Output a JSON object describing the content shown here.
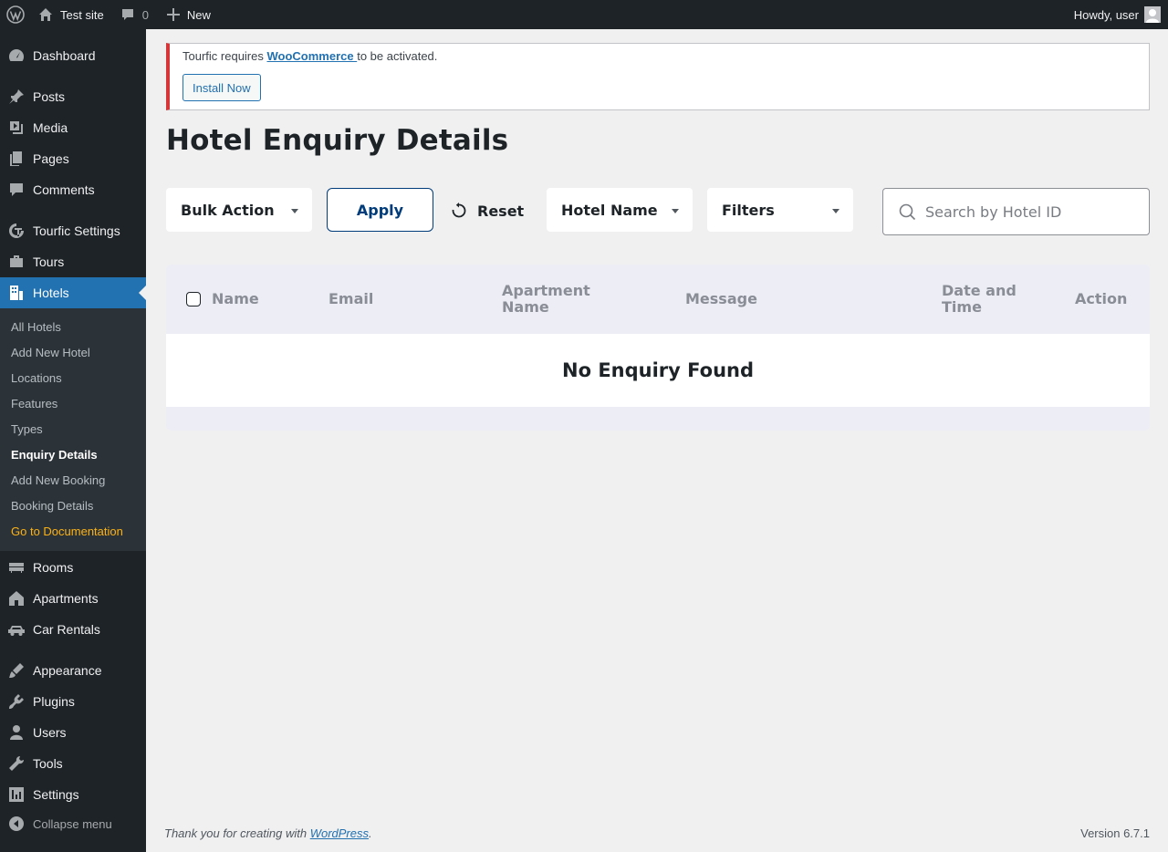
{
  "adminbar": {
    "site_name": "Test site",
    "comments_count": "0",
    "new_label": "New",
    "greeting": "Howdy, user"
  },
  "sidebar": {
    "items": [
      {
        "label": "Dashboard",
        "icon": "dashboard-icon"
      },
      {
        "label": "Posts",
        "icon": "pin-icon"
      },
      {
        "label": "Media",
        "icon": "media-icon"
      },
      {
        "label": "Pages",
        "icon": "pages-icon"
      },
      {
        "label": "Comments",
        "icon": "comment-icon"
      },
      {
        "label": "Tourfic Settings",
        "icon": "tourfic-icon"
      },
      {
        "label": "Tours",
        "icon": "tours-icon"
      },
      {
        "label": "Hotels",
        "icon": "hotel-icon"
      },
      {
        "label": "Rooms",
        "icon": "bed-icon"
      },
      {
        "label": "Apartments",
        "icon": "home-icon"
      },
      {
        "label": "Car Rentals",
        "icon": "car-icon"
      },
      {
        "label": "Appearance",
        "icon": "brush-icon"
      },
      {
        "label": "Plugins",
        "icon": "plugin-icon"
      },
      {
        "label": "Users",
        "icon": "user-icon"
      },
      {
        "label": "Tools",
        "icon": "wrench-icon"
      },
      {
        "label": "Settings",
        "icon": "settings-icon"
      }
    ],
    "submenu": [
      "All Hotels",
      "Add New Hotel",
      "Locations",
      "Features",
      "Types",
      "Enquiry Details",
      "Add New Booking",
      "Booking Details",
      "Go to Documentation"
    ],
    "collapse_label": "Collapse menu"
  },
  "notice": {
    "text_before": "Tourfic requires ",
    "link_text": "WooCommerce ",
    "text_after": "to be activated.",
    "button_label": "Install Now",
    "accent_color": "#d63638"
  },
  "page": {
    "title": "Hotel Enquiry Details"
  },
  "filters": {
    "bulk_action": "Bulk Action",
    "apply": "Apply",
    "reset": "Reset",
    "hotel_name": "Hotel Name",
    "filters": "Filters",
    "search_placeholder": "Search by Hotel ID"
  },
  "table": {
    "columns": [
      "Name",
      "Email",
      "Apartment Name",
      "Message",
      "Date and Time",
      "Action"
    ],
    "empty_message": "No Enquiry Found"
  },
  "footer": {
    "text_before": "Thank you for creating with ",
    "link_text": "WordPress",
    "text_after": ".",
    "version": "Version 6.7.1"
  },
  "colors": {
    "admin_bg": "#1d2327",
    "accent": "#2271b1",
    "apply_border": "#003c79",
    "doc_link": "#fcb214"
  }
}
